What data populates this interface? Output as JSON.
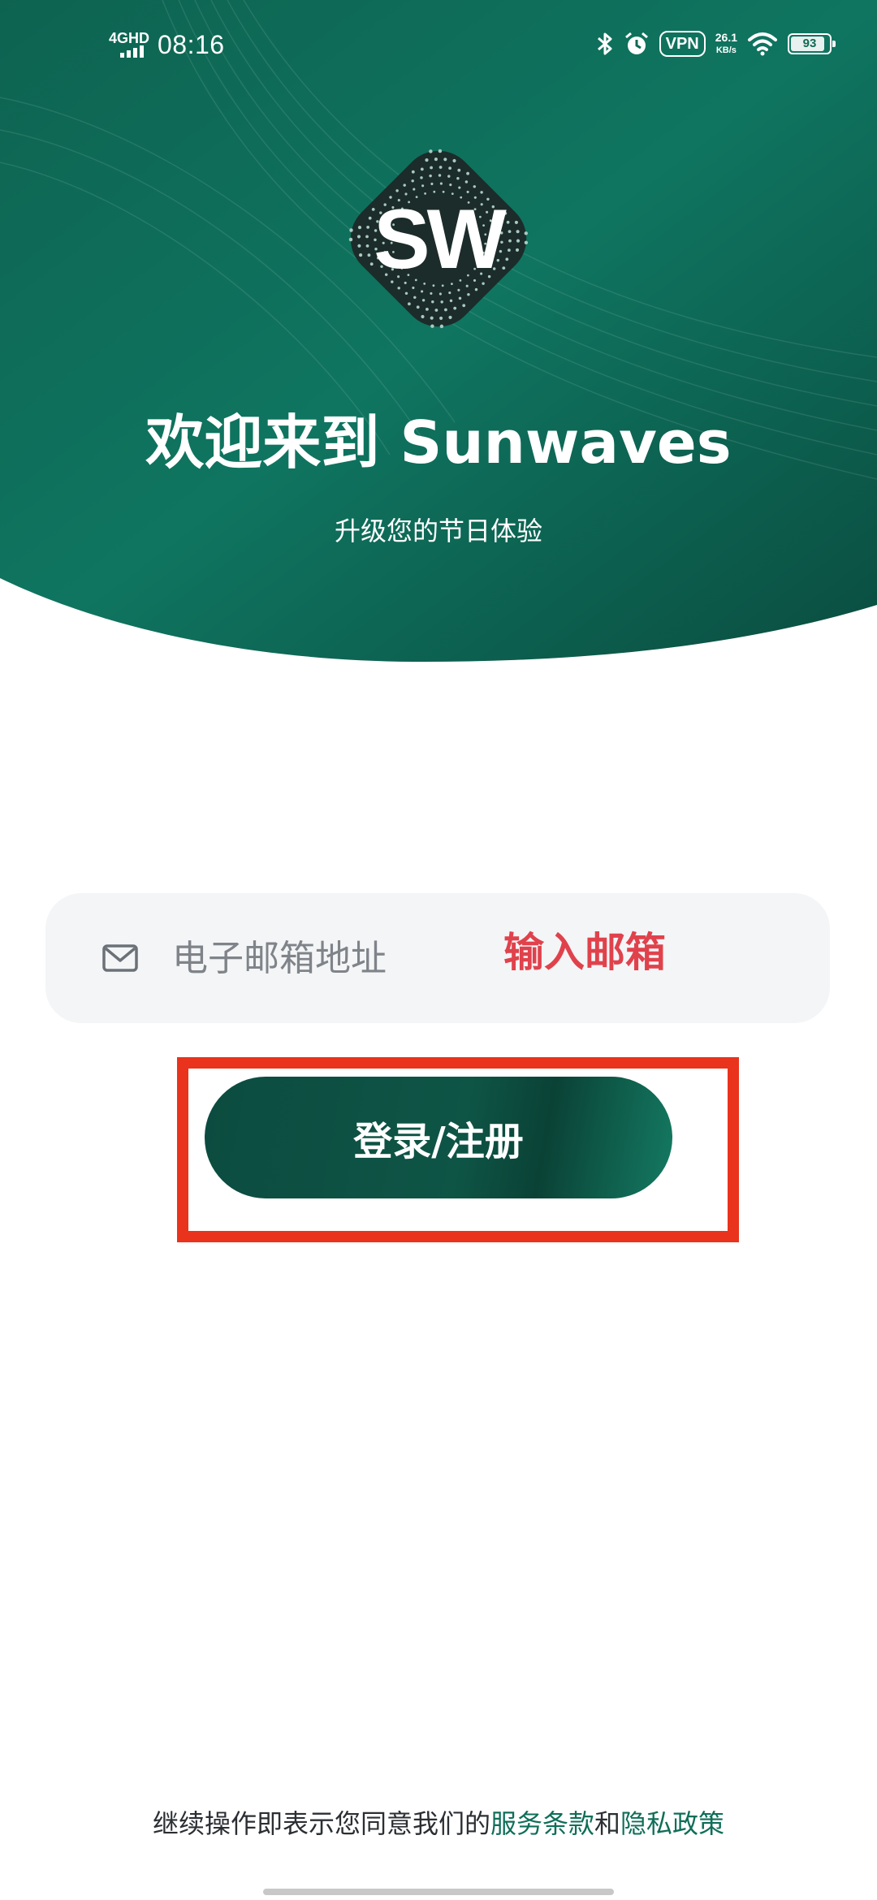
{
  "status_bar": {
    "network": "4GHD",
    "time": "08:16",
    "vpn": "VPN",
    "speed_value": "26.1",
    "speed_unit": "KB/s",
    "battery_level": 93,
    "battery_text": "93"
  },
  "logo": {
    "text": "SW"
  },
  "welcome": {
    "title": "欢迎来到 Sunwaves",
    "subtitle": "升级您的节日体验"
  },
  "email": {
    "placeholder": "电子邮箱地址",
    "value": "",
    "annotation": "输入邮箱"
  },
  "login": {
    "label": "登录/注册"
  },
  "terms": {
    "prefix": "继续操作即表示您同意我们的",
    "service_link": "服务条款",
    "and": "和",
    "privacy_link": "隐私政策"
  },
  "colors": {
    "brand_dark": "#0b4a3e",
    "brand_light": "#12806a",
    "link": "#0f6e58",
    "annotation": "#e0424c",
    "highlight": "#e9331c"
  }
}
